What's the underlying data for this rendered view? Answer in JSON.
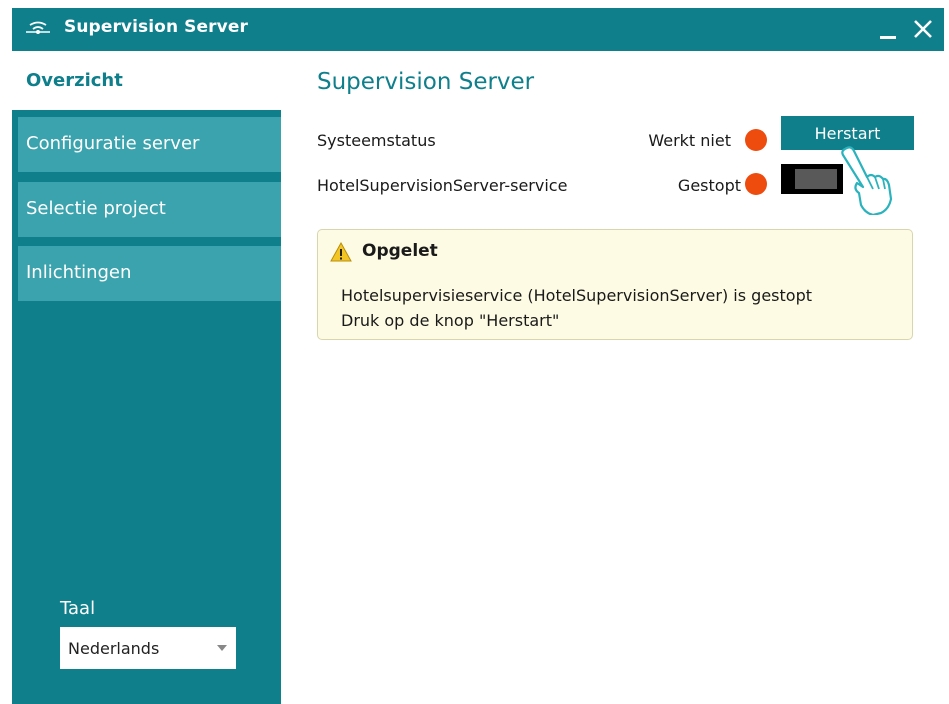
{
  "window": {
    "title": "Supervision Server",
    "icons": {
      "app": "antenna-icon",
      "minimize": "minimize-icon",
      "close": "close-icon"
    }
  },
  "sidebar": {
    "items": [
      {
        "label": "Overzicht",
        "active": true
      },
      {
        "label": "Configuratie server",
        "active": false
      },
      {
        "label": "Selectie project",
        "active": false
      },
      {
        "label": "Inlichtingen",
        "active": false
      }
    ],
    "language_label": "Taal",
    "language_value": "Nederlands"
  },
  "main": {
    "title": "Supervision Server",
    "rows": [
      {
        "label": "Systeemstatus",
        "status": "Werkt niet",
        "status_color": "#ee4b0e"
      },
      {
        "label": "HotelSupervisionServer-service",
        "status": "Gestopt",
        "status_color": "#ee4b0e"
      }
    ],
    "restart_label": "Herstart",
    "service_toggle_on": false,
    "warning": {
      "title": "Opgelet",
      "line1": "Hotelsupervisieservice (HotelSupervisionServer) is gestopt",
      "line2": "Druk op de knop \"Herstart\""
    }
  },
  "colors": {
    "accent": "#0e7f8b",
    "nav_inactive": "#3aa3ad",
    "status_red": "#ee4b0e",
    "warning_bg": "#fdfbe3"
  }
}
